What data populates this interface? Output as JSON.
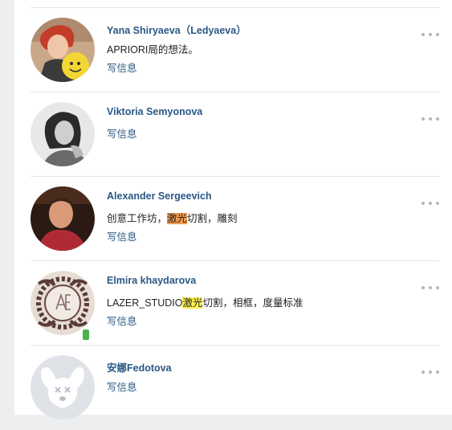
{
  "friends": [
    {
      "name": "Yana Shiryaeva（Ledyaeva）",
      "status_parts": [
        {
          "text": "APRIORI局的想法。"
        }
      ],
      "action": "写信息",
      "avatar": "photo-red-hair-woman",
      "mobile": false
    },
    {
      "name": "Viktoria Semyonova",
      "status_parts": [],
      "action": "写信息",
      "avatar": "photo-bw-woman",
      "mobile": false
    },
    {
      "name": "Alexander Sergeevich",
      "status_parts": [
        {
          "text": "创意工作坊，"
        },
        {
          "text": "激光",
          "highlight": "#f59a4a"
        },
        {
          "text": "切割，雕刻"
        }
      ],
      "action": "写信息",
      "avatar": "photo-man-red-shirt",
      "mobile": false
    },
    {
      "name": "Elmira khaydarova",
      "status_parts": [
        {
          "text": "LAZER_STUDIO"
        },
        {
          "text": "激光",
          "highlight": "#fdf04f"
        },
        {
          "text": "切割，相框，度量标准"
        }
      ],
      "action": "写信息",
      "avatar": "ornament-monogram",
      "mobile": true
    },
    {
      "name": "安娜Fedotova",
      "status_parts": [],
      "action": "写信息",
      "avatar": "default-dog-avatar",
      "mobile": false
    }
  ],
  "colors": {
    "name": "#2a5885",
    "separator": "#e7e8ec",
    "page_bg": "#edeef0",
    "menu_dots": "#aeb7c2",
    "online_mobile": "#4bb34b"
  }
}
